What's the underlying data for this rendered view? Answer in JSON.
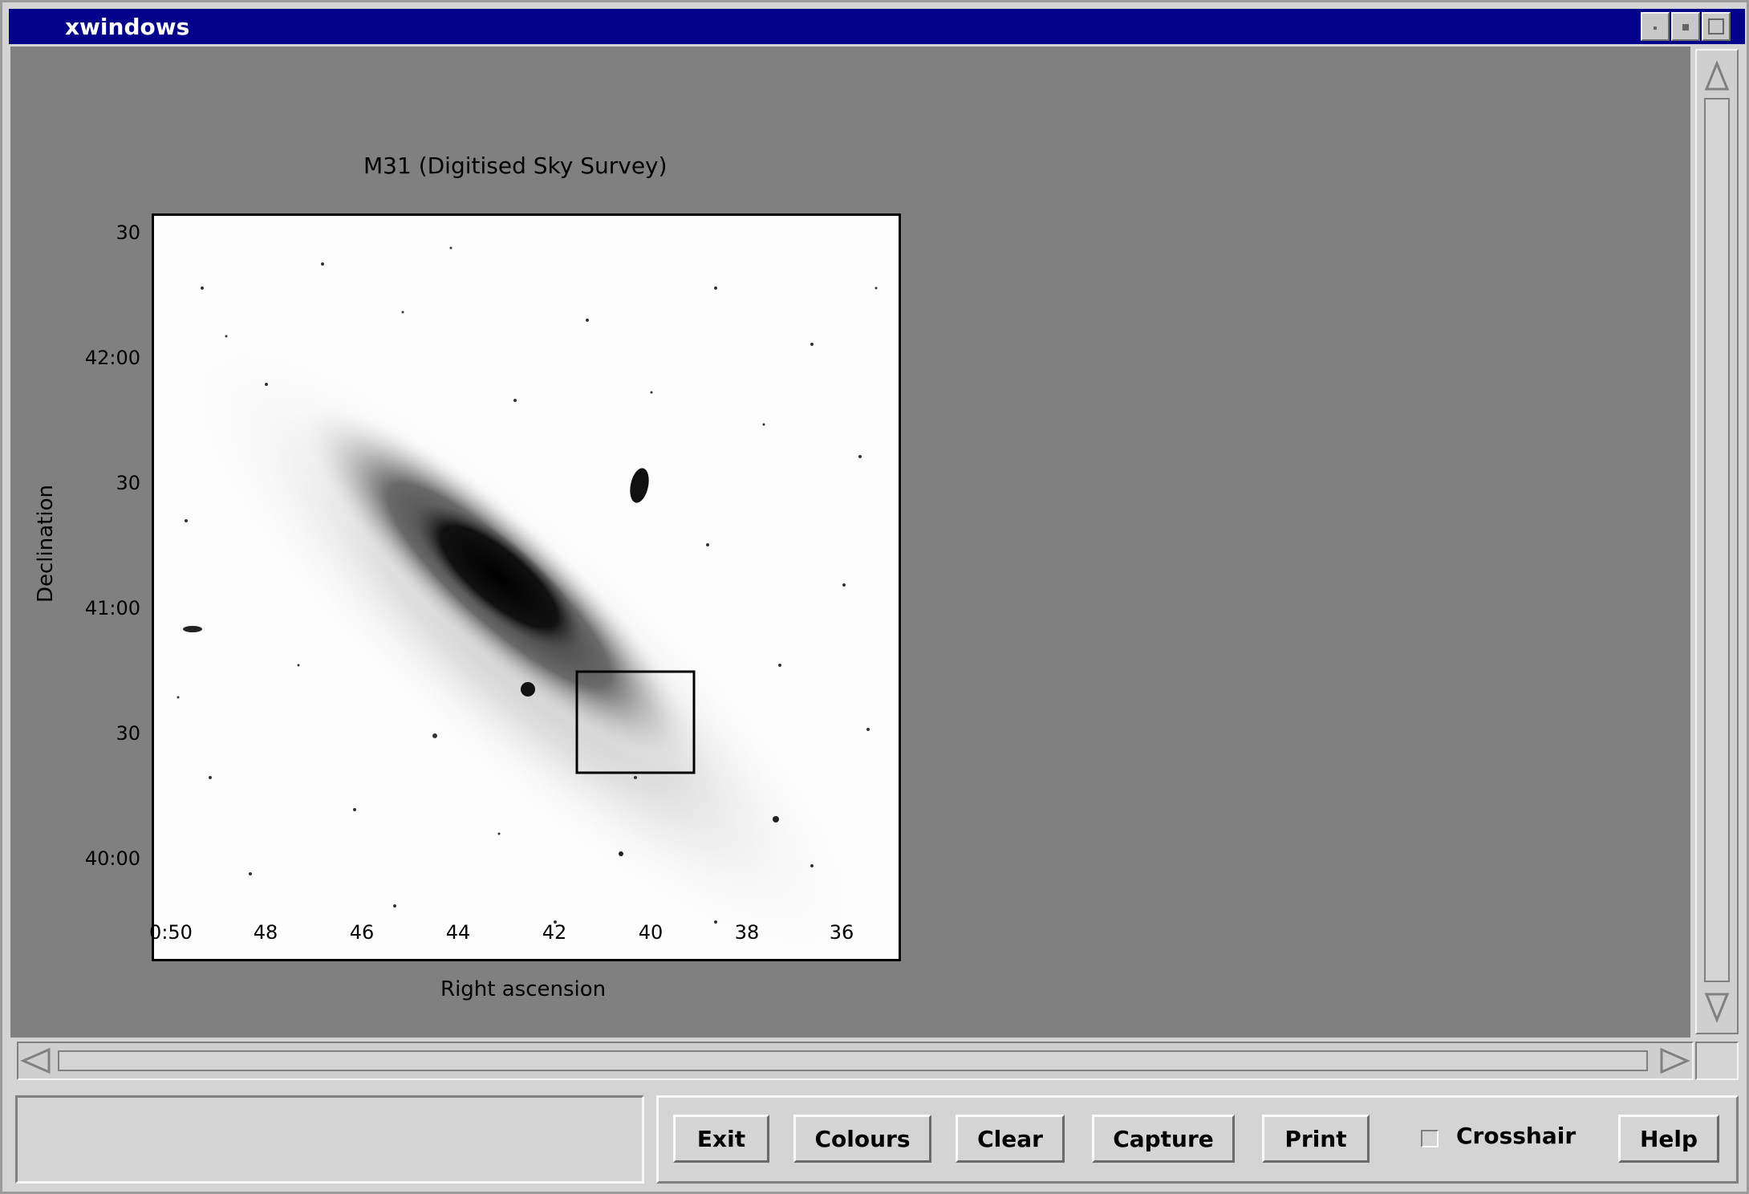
{
  "window": {
    "title": "xwindows"
  },
  "plot": {
    "title": "M31 (Digitised Sky Survey)",
    "x_axis_title": "Right ascension",
    "y_axis_title": "Declination",
    "y_ticks": [
      "30",
      "42:00",
      "30",
      "41:00",
      "30",
      "40:00"
    ],
    "x_ticks": [
      "0:50",
      "48",
      "46",
      "44",
      "42",
      "40",
      "38",
      "36"
    ]
  },
  "buttons": {
    "exit": "Exit",
    "colours": "Colours",
    "clear": "Clear",
    "capture": "Capture",
    "print": "Print",
    "crosshair": "Crosshair",
    "help": "Help"
  },
  "status_text": ""
}
